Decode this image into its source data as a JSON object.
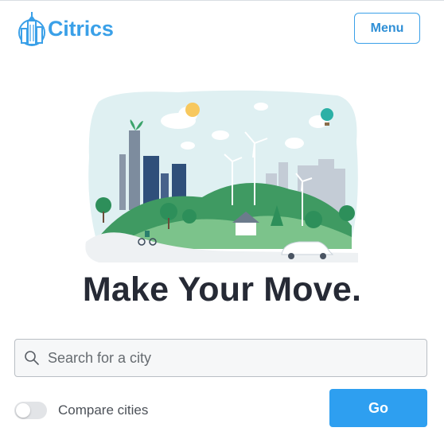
{
  "header": {
    "logo_text": "Citrics",
    "menu_label": "Menu"
  },
  "hero": {
    "illustration": "city-skyline-illustration"
  },
  "main": {
    "headline": "Make Your Move.",
    "search": {
      "placeholder": "Search for a city",
      "value": "",
      "icon": "search-icon"
    },
    "compare": {
      "label": "Compare cities",
      "enabled": false
    },
    "go_label": "Go"
  },
  "colors": {
    "brand": "#3aa0e8",
    "primary_button": "#2e9ff0",
    "headline": "#262a35"
  }
}
